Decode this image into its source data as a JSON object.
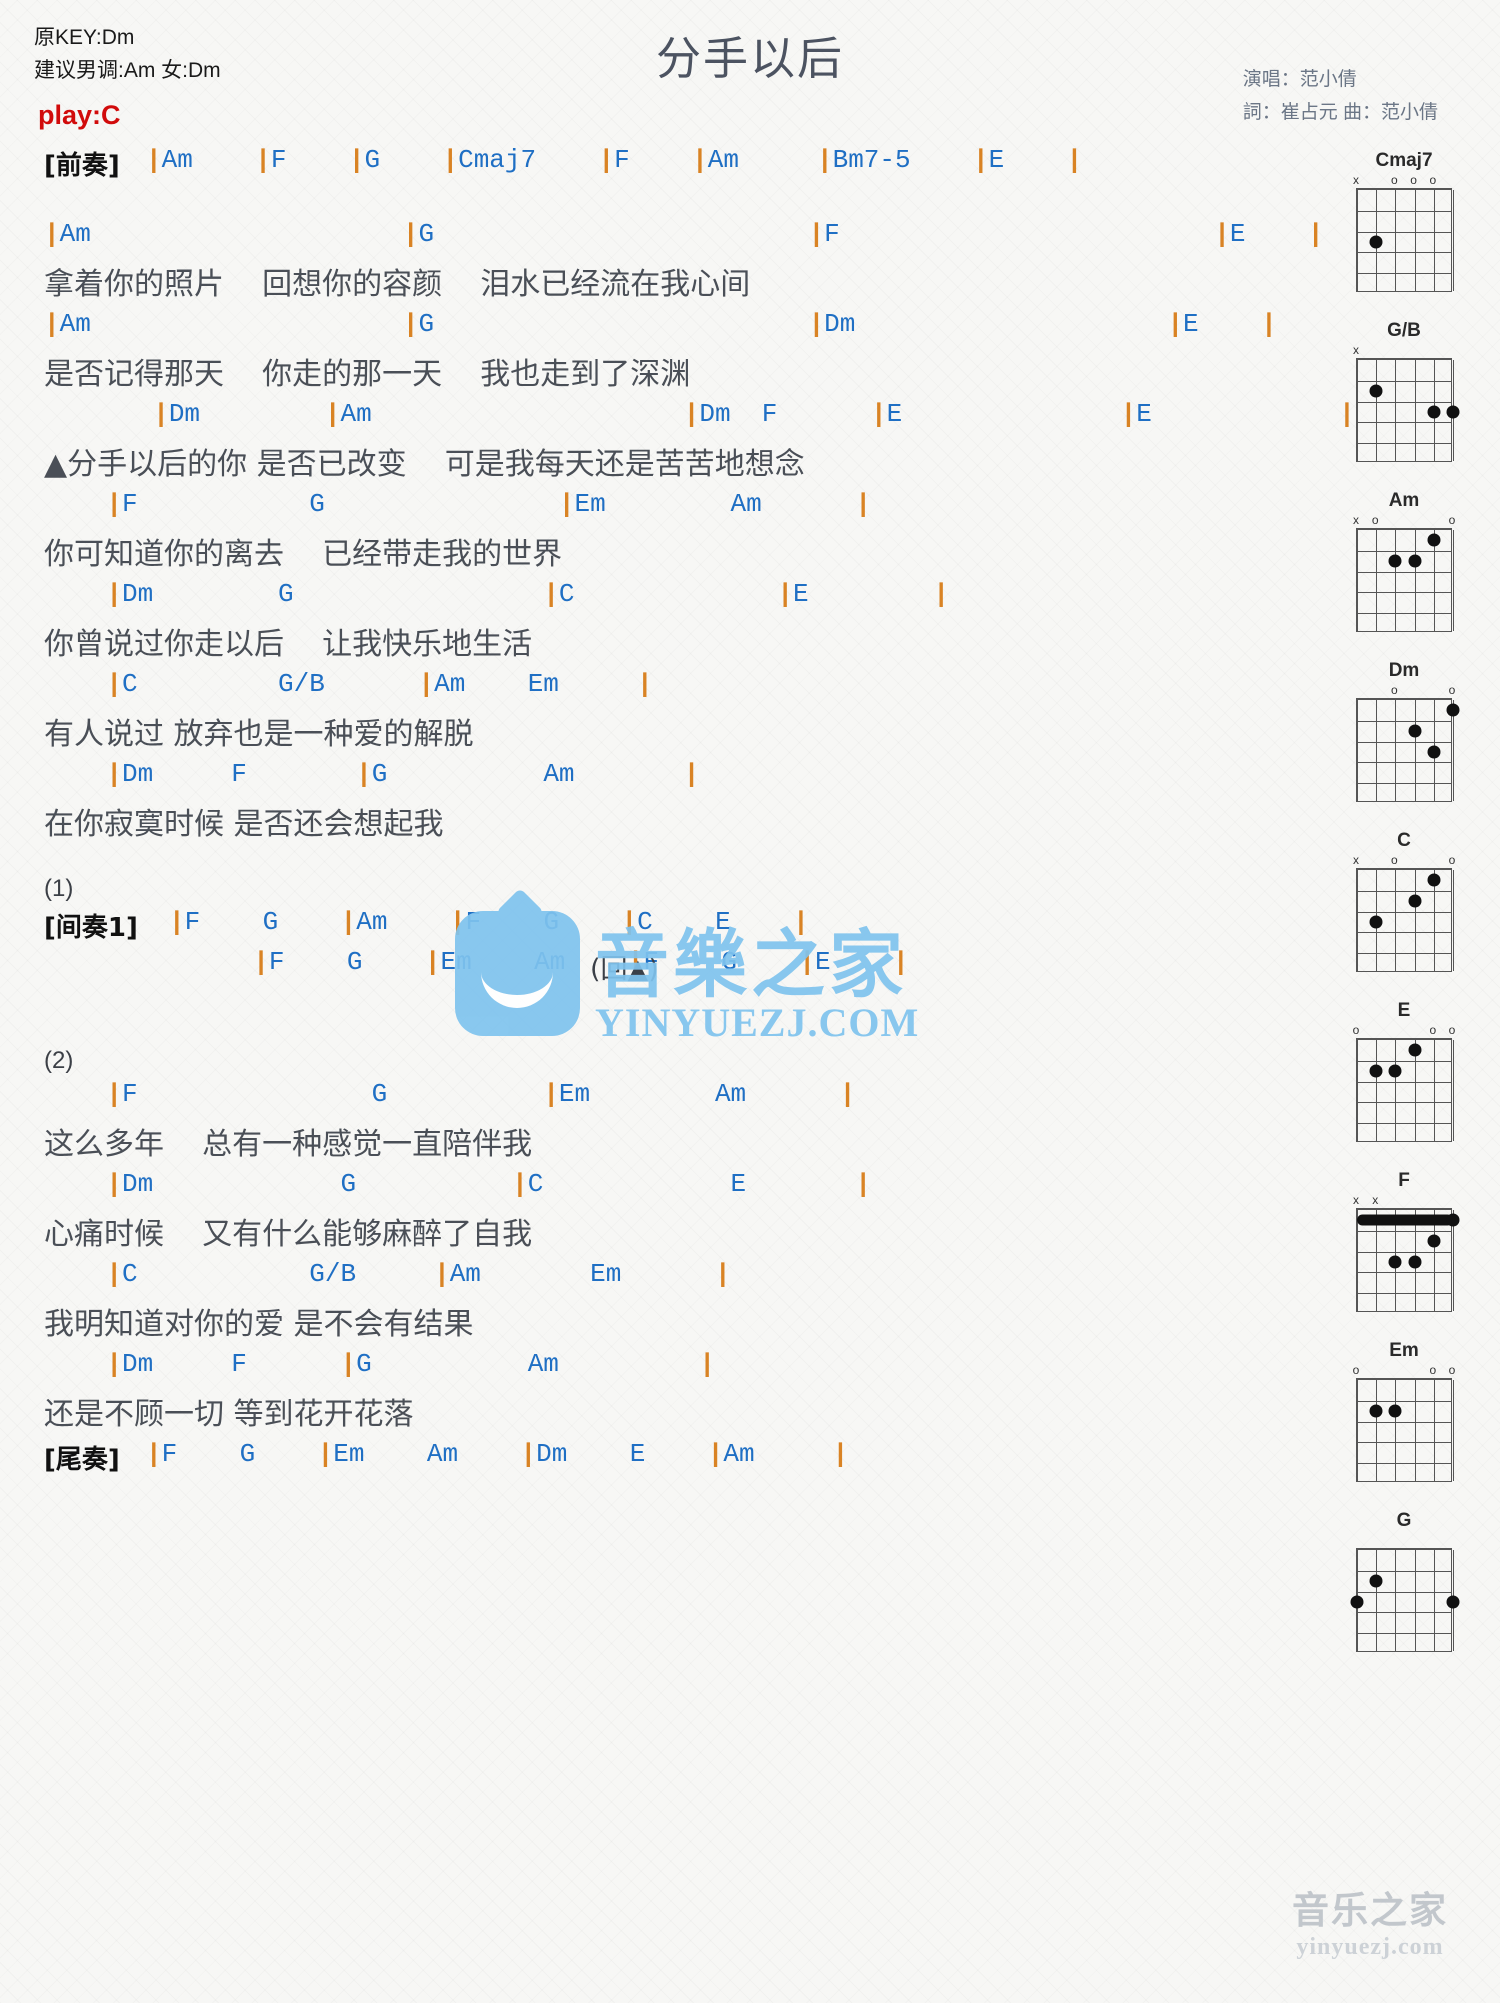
{
  "header": {
    "orig_key": "原KEY:Dm",
    "suggest_key": "建议男调:Am 女:Dm",
    "play_key": "play:C",
    "title": "分手以后",
    "singer": "演唱：范小倩",
    "writers": "詞：崔占元   曲：范小倩",
    "play_key_color": "#d10b0b",
    "chord_color": "#1f6fc4",
    "bar_color": "#d98324"
  },
  "sections": [
    {
      "name": "intro",
      "tag": "[前奏]",
      "chords": "|Am    |F    |G    |Cmaj7    |F    |Am     |Bm7-5    |E    |"
    },
    {
      "name": "verse-1a",
      "chords": "|Am                    |G                        |F                        |E    |",
      "lyrics": "拿着你的照片    回想你的容颜    泪水已经流在我心间"
    },
    {
      "name": "verse-1b",
      "chords": "|Am                    |G                        |Dm                    |E    |",
      "lyrics": "是否记得那天    你走的那一天    我也走到了深渊"
    },
    {
      "name": "chorus-1a",
      "chords": "       |Dm        |Am                    |Dm  F      |E              |E            |",
      "lyrics": "▲分手以后的你 是否已改变    可是我每天还是苦苦地想念"
    },
    {
      "name": "chorus-1b",
      "chords": "    |F           G               |Em        Am      |",
      "lyrics": "你可知道你的离去    已经带走我的世界"
    },
    {
      "name": "chorus-1c",
      "chords": "    |Dm        G                |C             |E        |",
      "lyrics": "你曾说过你走以后    让我快乐地生活"
    },
    {
      "name": "chorus-1d",
      "chords": "    |C         G/B      |Am    Em     |",
      "lyrics": "有人说过 放弃也是一种爱的解脱"
    },
    {
      "name": "chorus-1e",
      "chords": "    |Dm     F       |G          Am       |",
      "lyrics": "在你寂寞时候 是否还会想起我"
    },
    {
      "name": "interlude-mark-1",
      "marker": "(1)"
    },
    {
      "name": "interlude-1",
      "tag": "[间奏1]",
      "chords": "|F    G    |Am    |F    G    |C    E    |",
      "chords_2": "       |F    G    |Em    Am    |F    G    |E    |",
      "note": "(回▲)"
    },
    {
      "name": "interlude-mark-2",
      "marker": "(2)"
    },
    {
      "name": "verse-2a",
      "chords": "    |F               G          |Em        Am      |",
      "lyrics": "这么多年    总有一种感觉一直陪伴我"
    },
    {
      "name": "verse-2b",
      "chords": "    |Dm            G          |C            E       |",
      "lyrics": "心痛时候    又有什么能够麻醉了自我"
    },
    {
      "name": "verse-2c",
      "chords": "    |C           G/B     |Am       Em      |",
      "lyrics": "我明知道对你的爱 是不会有结果"
    },
    {
      "name": "verse-2d",
      "chords": "    |Dm     F      |G          Am         |",
      "lyrics": "还是不顾一切 等到花开花落"
    },
    {
      "name": "outro",
      "tag": "[尾奏]",
      "chords": "|F    G    |Em    Am    |Dm    E    |Am     |"
    }
  ],
  "diagrams": [
    {
      "name": "Cmaj7",
      "top": [
        {
          "string": 1,
          "mark": "x"
        },
        {
          "string": 3,
          "mark": "o"
        },
        {
          "string": 4,
          "mark": "o"
        },
        {
          "string": 5,
          "mark": "o"
        }
      ],
      "dots": [
        {
          "string": 2,
          "fret": 3
        },
        {
          "string": 6,
          "fret": 0
        }
      ],
      "frets": 5
    },
    {
      "name": "G/B",
      "top": [
        {
          "string": 1,
          "mark": "x"
        }
      ],
      "dots": [
        {
          "string": 2,
          "fret": 2
        },
        {
          "string": 5,
          "fret": 3
        },
        {
          "string": 6,
          "fret": 3
        }
      ],
      "frets": 5
    },
    {
      "name": "Am",
      "top": [
        {
          "string": 1,
          "mark": "x"
        },
        {
          "string": 2,
          "mark": "o"
        },
        {
          "string": 6,
          "mark": "o"
        }
      ],
      "dots": [
        {
          "string": 3,
          "fret": 2
        },
        {
          "string": 4,
          "fret": 2
        },
        {
          "string": 5,
          "fret": 1
        }
      ],
      "frets": 5
    },
    {
      "name": "Dm",
      "top": [
        {
          "string": 3,
          "mark": "o"
        },
        {
          "string": 6,
          "mark": "o"
        }
      ],
      "dots": [
        {
          "string": 4,
          "fret": 2
        },
        {
          "string": 5,
          "fret": 3
        },
        {
          "string": 6,
          "fret": 1
        }
      ],
      "frets": 5
    },
    {
      "name": "C",
      "top": [
        {
          "string": 1,
          "mark": "x"
        },
        {
          "string": 3,
          "mark": "o"
        },
        {
          "string": 6,
          "mark": "o"
        }
      ],
      "dots": [
        {
          "string": 2,
          "fret": 3
        },
        {
          "string": 4,
          "fret": 2
        },
        {
          "string": 5,
          "fret": 1
        }
      ],
      "frets": 5
    },
    {
      "name": "E",
      "top": [
        {
          "string": 1,
          "mark": "o"
        },
        {
          "string": 5,
          "mark": "o"
        },
        {
          "string": 6,
          "mark": "o"
        }
      ],
      "dots": [
        {
          "string": 2,
          "fret": 2
        },
        {
          "string": 3,
          "fret": 2
        },
        {
          "string": 4,
          "fret": 1
        }
      ],
      "frets": 5
    },
    {
      "name": "F",
      "top": [
        {
          "string": 1,
          "mark": "x"
        },
        {
          "string": 2,
          "mark": "x"
        }
      ],
      "dots": [
        {
          "string": 3,
          "fret": 3
        },
        {
          "string": 4,
          "fret": 3
        },
        {
          "string": 5,
          "fret": 2
        },
        {
          "string": 6,
          "fret": 1
        }
      ],
      "barre": {
        "fret": 1
      },
      "frets": 5
    },
    {
      "name": "Em",
      "top": [
        {
          "string": 1,
          "mark": "o"
        },
        {
          "string": 5,
          "mark": "o"
        },
        {
          "string": 6,
          "mark": "o"
        }
      ],
      "dots": [
        {
          "string": 2,
          "fret": 2
        },
        {
          "string": 3,
          "fret": 2
        }
      ],
      "frets": 5
    },
    {
      "name": "G",
      "top": [],
      "dots": [
        {
          "string": 1,
          "fret": 3
        },
        {
          "string": 2,
          "fret": 2
        },
        {
          "string": 6,
          "fret": 3
        }
      ],
      "frets": 5
    }
  ],
  "watermark": {
    "main_cn": "音樂之家",
    "main_en": "YINYUEZJ.COM",
    "footer_cn": "音乐之家",
    "footer_en": "yinyuezj.com",
    "color": "#7fc3ee"
  }
}
